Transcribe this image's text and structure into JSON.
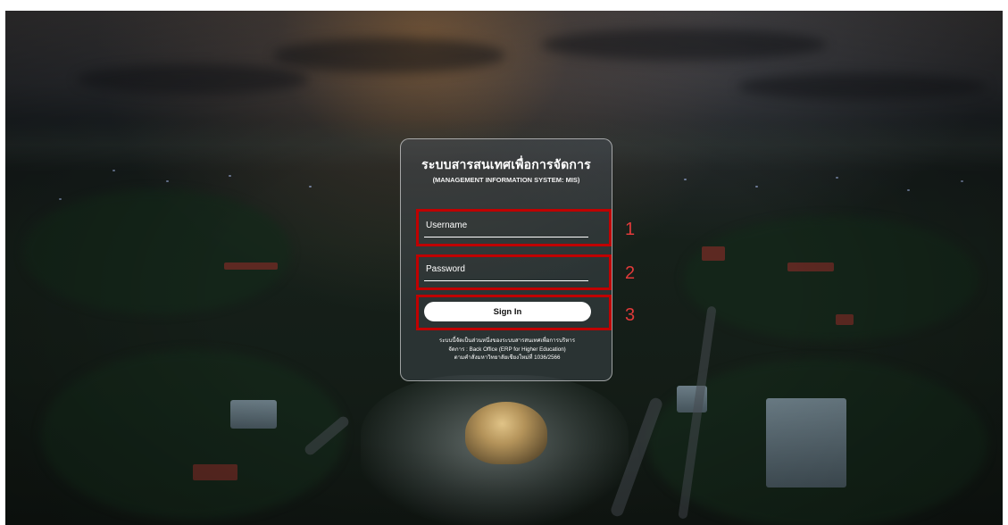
{
  "login": {
    "title": "ระบบสารสนเทศเพื่อการจัดการ",
    "subtitle": "(MANAGEMENT INFORMATION SYSTEM: MIS)",
    "username_placeholder": "Username",
    "password_placeholder": "Password",
    "signin_label": "Sign In",
    "note_lines": [
      "ระบบนี้จัดเป็นส่วนหนึ่งของระบบสารสนเทศเพื่อการบริหาร",
      "จัดการ : Back Office (ERP for Higher Education)",
      "ตามคำสั่งมหาวิทยาลัยเชียงใหม่ที่ 1036/2566"
    ]
  },
  "annotations": {
    "labels": [
      "1",
      "2",
      "3"
    ],
    "color": "#c00000"
  }
}
